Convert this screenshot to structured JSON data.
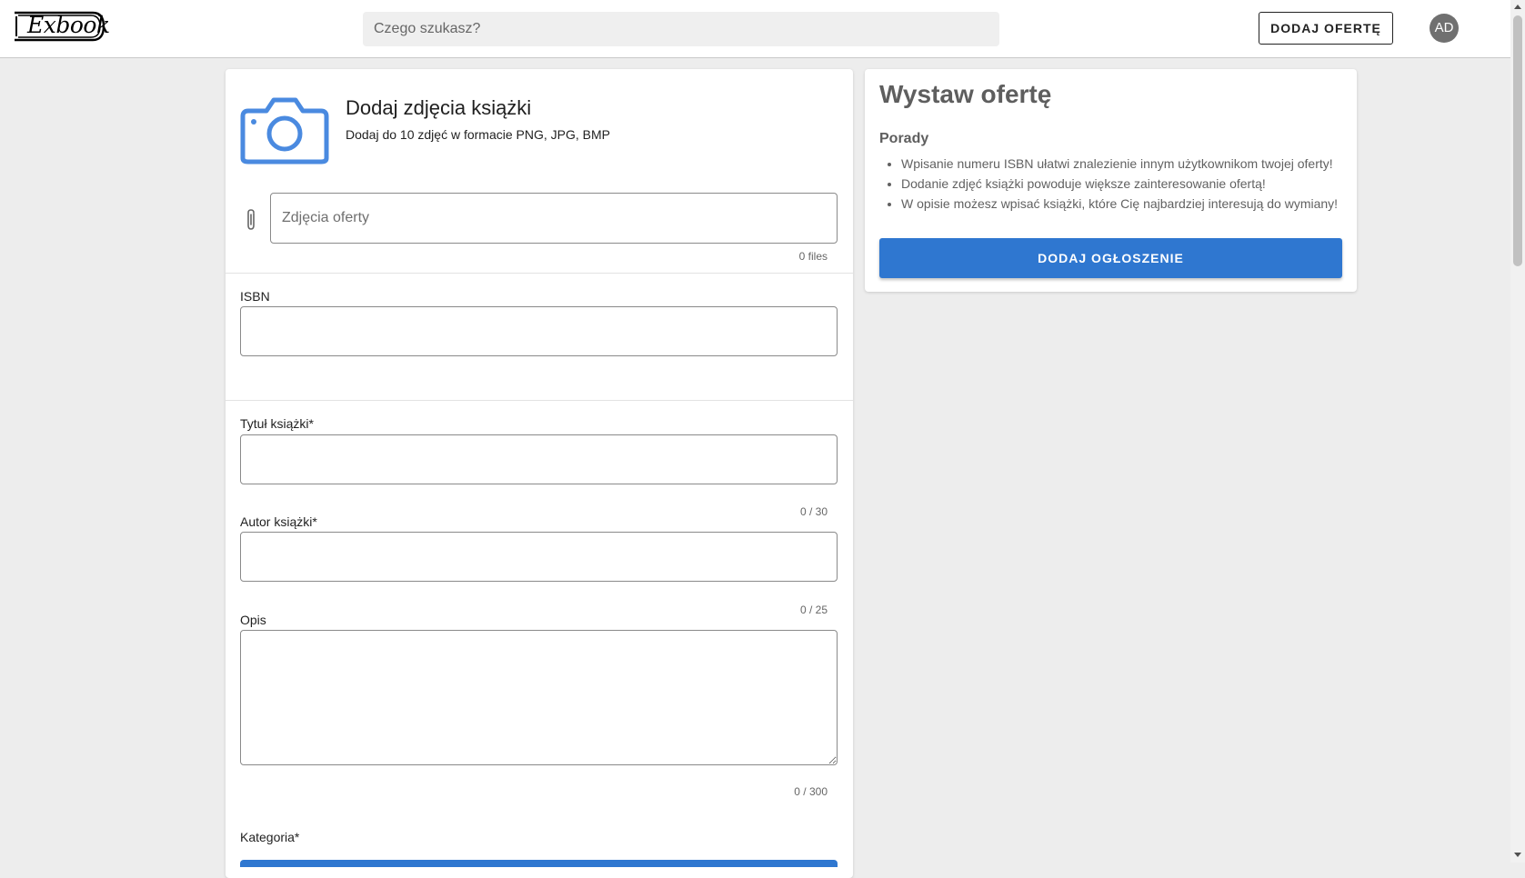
{
  "header": {
    "logo_text": "Exbook",
    "search_placeholder": "Czego szukasz?",
    "add_offer_label": "DODAJ OFERTĘ",
    "avatar_initials": "AD"
  },
  "photos": {
    "title": "Dodaj zdjęcia książki",
    "subtitle": "Dodaj do 10 zdjęć w formacie PNG, JPG, BMP",
    "input_placeholder": "Zdjęcia oferty",
    "files_count": "0 files"
  },
  "form": {
    "isbn_label": "ISBN",
    "isbn_value": "",
    "title_label": "Tytuł książki*",
    "title_value": "",
    "title_counter": "0 / 30",
    "author_label": "Autor książki*",
    "author_value": "",
    "author_counter": "0 / 25",
    "description_label": "Opis",
    "description_value": "",
    "description_counter": "0 / 300",
    "category_label": "Kategoria*"
  },
  "sidebar": {
    "title": "Wystaw ofertę",
    "tips_heading": "Porady",
    "tips": [
      "Wpisanie numeru ISBN ułatwi znalezienie innym użytkownikom twojej oferty!",
      "Dodanie zdjęć książki powoduje większe zainteresowanie ofertą!",
      "W opisie możesz wpisać książki, które Cię najbardziej interesują do wymiany!"
    ],
    "submit_label": "DODAJ OGŁOSZENIE"
  },
  "colors": {
    "accent": "#2f77d0",
    "icon_blue": "#4a8ae0",
    "background": "#ededed",
    "avatar": "#707070"
  }
}
